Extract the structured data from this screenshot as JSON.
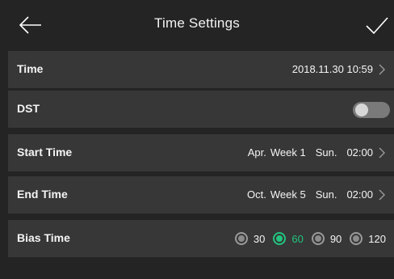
{
  "header": {
    "title": "Time Settings",
    "back_icon": "arrow-left-icon",
    "confirm_icon": "checkmark-icon"
  },
  "rows": {
    "time": {
      "label": "Time",
      "value": "2018.11.30  10:59"
    },
    "dst": {
      "label": "DST",
      "enabled": false
    },
    "start_time": {
      "label": "Start Time",
      "month": "Apr.",
      "week": "Week 1",
      "day": "Sun.",
      "time": "02:00"
    },
    "end_time": {
      "label": "End Time",
      "month": "Oct.",
      "week": "Week 5",
      "day": "Sun.",
      "time": "02:00"
    },
    "bias_time": {
      "label": "Bias Time",
      "options": [
        "30",
        "60",
        "90",
        "120"
      ],
      "selected": "60"
    }
  },
  "colors": {
    "background": "#242424",
    "row_background": "#373737",
    "accent": "#21c47e",
    "text": "#f4f4f4"
  }
}
